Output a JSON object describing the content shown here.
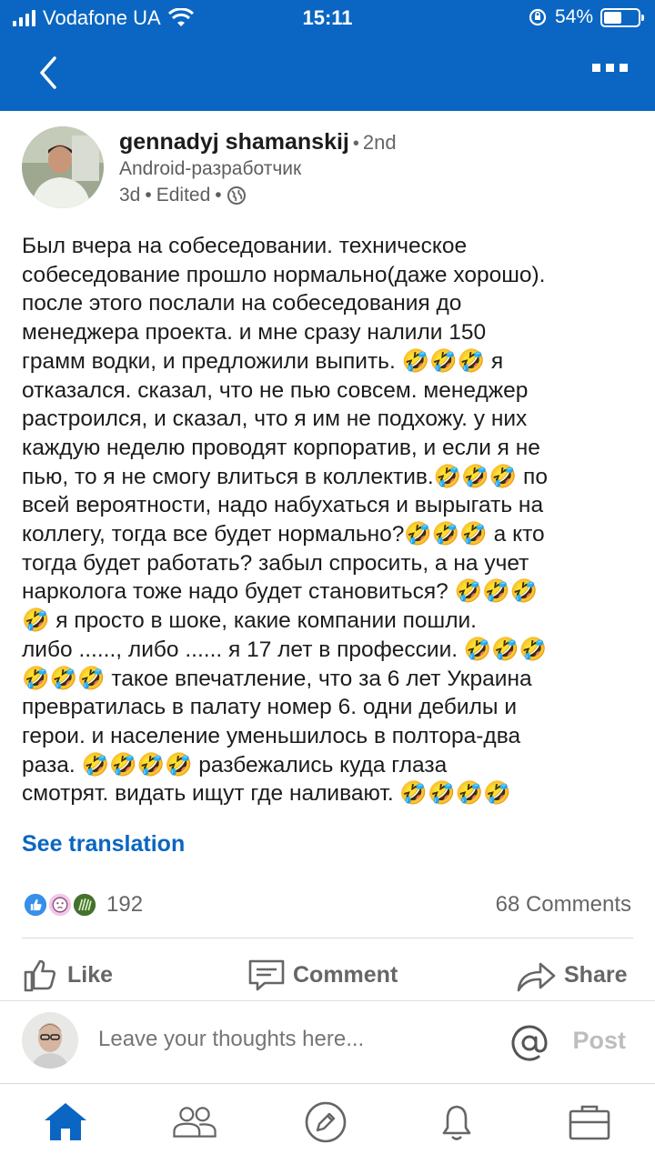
{
  "status_bar": {
    "carrier": "Vodafone UA",
    "time": "15:11",
    "battery": "54%",
    "battery_level": 0.54
  },
  "author": {
    "name": "gennadyj shamanskij",
    "degree": "2nd",
    "headline": "Android-разработчик",
    "time": "3d",
    "edited": "Edited"
  },
  "post": {
    "text": "Был вчера на собеседовании. техническое\nсобеседование прошло нормально(даже хорошо).\nпосле этого послали на собеседования до\nменеджера проекта. и мне сразу налили 150\nграмм водки, и предложили выпить. 🤣🤣🤣  я\nотказался. сказал, что не пью совсем.  менеджер\nрастроился, и сказал, что я им не подхожу. у них\nкаждую неделю проводят корпоратив, и если я не\nпью, то я не смогу влиться в коллектив.🤣🤣🤣 по\nвсей вероятности, надо набухаться и вырыгать на\nколлегу, тогда все будет нормально?🤣🤣🤣 а кто\nтогда будет работать? забыл спросить, а на учет\nнарколога тоже надо будет становиться? 🤣🤣🤣\n🤣 я просто в шоке, какие компании пошли.\nлибо ......, либо ...... я 17 лет в профессии. 🤣🤣🤣\n🤣🤣🤣 такое впечатление, что за 6 лет Украина\nпревратилась в палату номер 6. одни дебилы и\nгерои. и население уменьшилось в полтора-два\nраза. 🤣🤣🤣🤣  разбежались куда глаза\nсмотрят. видать ищут где наливают. 🤣🤣🤣🤣",
    "see_translation": "See translation"
  },
  "social": {
    "reactions_count": "192",
    "comments_count": "68 Comments"
  },
  "actions": {
    "like": "Like",
    "comment": "Comment",
    "share": "Share"
  },
  "comment_box": {
    "placeholder": "Leave your thoughts here...",
    "post": "Post"
  },
  "colors": {
    "brand": "#0a66c2",
    "secondary_text": "#666666"
  }
}
